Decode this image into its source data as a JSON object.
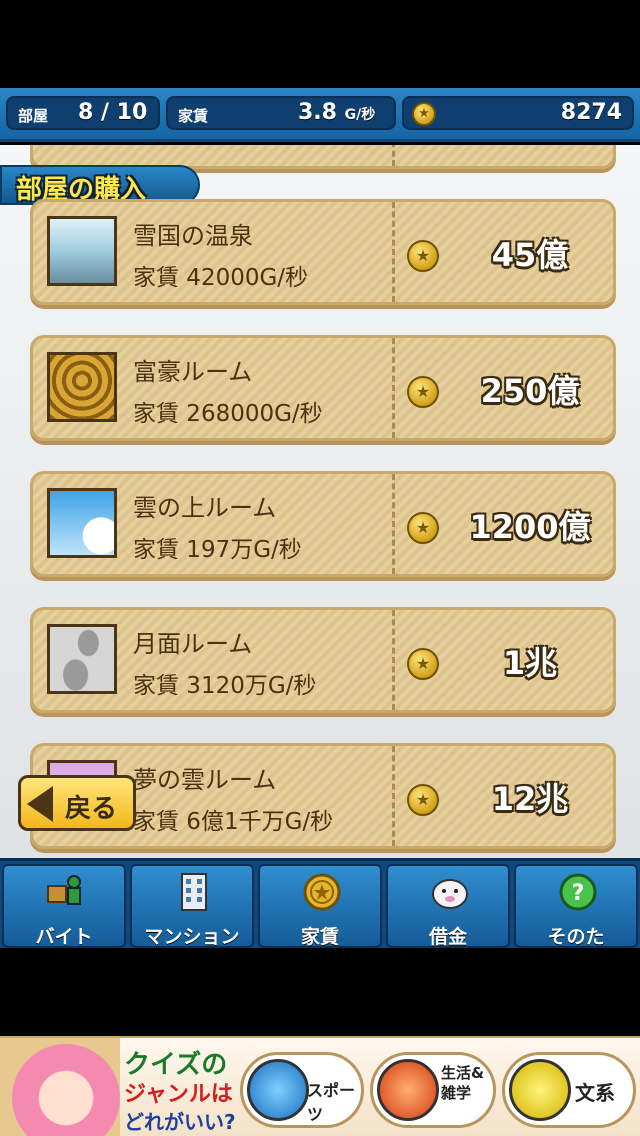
{
  "status": {
    "rooms_label": "部屋",
    "rooms_value": "8 / 10",
    "rent_label": "家賃",
    "rent_value": "3.8",
    "rent_unit": "G/秒",
    "money_value": "8274"
  },
  "section_title": "部屋の購入",
  "rooms": [
    {
      "name": "雪国の温泉",
      "rent": "家賃 42000G/秒",
      "price": "45億"
    },
    {
      "name": "富豪ルーム",
      "rent": "家賃 268000G/秒",
      "price": "250億"
    },
    {
      "name": "雲の上ルーム",
      "rent": "家賃 197万G/秒",
      "price": "1200億"
    },
    {
      "name": "月面ルーム",
      "rent": "家賃 3120万G/秒",
      "price": "1兆"
    },
    {
      "name": "夢の雲ルーム",
      "rent": "家賃 6億1千万G/秒",
      "price": "12兆"
    }
  ],
  "back_label": "戻る",
  "nav": [
    {
      "label": "バイト",
      "icon": "worker-icon"
    },
    {
      "label": "マンション",
      "icon": "building-icon"
    },
    {
      "label": "家賃",
      "icon": "coin-icon"
    },
    {
      "label": "借金",
      "icon": "ghost-icon"
    },
    {
      "label": "そのた",
      "icon": "question-icon"
    }
  ],
  "ad": {
    "line1": "クイズの",
    "line2": "ジャンルは",
    "line3": "どれがいい?",
    "options": [
      "スポーツ",
      "生活&雑学",
      "文系"
    ]
  },
  "colors": {
    "nav_blue": "#1664a3",
    "card_tan": "#e6cf9f",
    "title_yellow": "#ffe84a"
  }
}
